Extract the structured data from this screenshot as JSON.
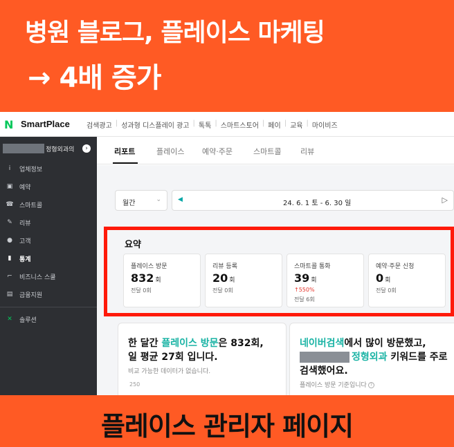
{
  "banner": {
    "headline": "병원 블로그, 플레이스 마케팅",
    "subline": "→ 4배 증가",
    "bottom": "플레이스 관리자 페이지"
  },
  "topbar": {
    "logo_mark": "N",
    "logo_text": "SmartPlace",
    "nav": [
      "검색광고",
      "성과형 디스플레이 광고",
      "톡톡",
      "스마트스토어",
      "페이",
      "교육",
      "마이비즈"
    ]
  },
  "sidebar": {
    "store_suffix": "정형외과의",
    "store_chevron": "›",
    "items": [
      {
        "label": "업체정보",
        "icon": "info-icon",
        "glyph": "i"
      },
      {
        "label": "예약",
        "icon": "calendar-icon",
        "glyph": "▣"
      },
      {
        "label": "스마트콜",
        "icon": "phone-icon",
        "glyph": "☎"
      },
      {
        "label": "리뷰",
        "icon": "pencil-icon",
        "glyph": "✎"
      },
      {
        "label": "고객",
        "icon": "users-icon",
        "glyph": "●"
      },
      {
        "label": "통계",
        "icon": "chart-icon",
        "glyph": "▮"
      },
      {
        "label": "비즈니스 스쿨",
        "icon": "school-icon",
        "glyph": "⌐"
      },
      {
        "label": "금융지원",
        "icon": "finance-icon",
        "glyph": "▤"
      },
      {
        "label": "솔루션",
        "icon": "solution-icon",
        "glyph": "✕"
      }
    ]
  },
  "tabs": [
    "리포트",
    "플레이스",
    "예약·주문",
    "스마트콜",
    "리뷰"
  ],
  "filters": {
    "period": "월간",
    "period_chevron": "⌄",
    "prev_glyph": "◀",
    "date_range": "24. 6. 1 토  -  6. 30 일",
    "next_glyph": "▷"
  },
  "summary": {
    "title": "요약",
    "cards": [
      {
        "label": "플레이스 방문",
        "value": "832",
        "unit": "회",
        "change": "",
        "prev": "전달 0회"
      },
      {
        "label": "리뷰 등록",
        "value": "20",
        "unit": "회",
        "change": "",
        "prev": "전달 0회"
      },
      {
        "label": "스마트콜 통화",
        "value": "39",
        "unit": "회",
        "change": "↑550%",
        "prev": "전달 6회"
      },
      {
        "label": "예약·주문 신청",
        "value": "0",
        "unit": "회",
        "change": "",
        "prev": "전달 0회"
      }
    ]
  },
  "panel_left": {
    "line1_a": "한 달간 ",
    "line1_hl": "플레이스 방문",
    "line1_b": "은 832회,",
    "line2": "일 평균 27회 입니다.",
    "note": "비교 가능한 데이터가 없습니다.",
    "tick": "250"
  },
  "panel_right": {
    "line1_hl": "네이버검색",
    "line1_b": "에서 많이 방문했고,",
    "line2_hl": "정형외과",
    "line2_b": " 키워드를 주로",
    "line3": "검색했어요.",
    "note": "플레이스 방문 기준입니다",
    "help": "?"
  },
  "colors": {
    "banner": "#ff5a24",
    "naver_green": "#03c75a",
    "highlight_box": "#ff1a0a",
    "teal_accent": "#19b3a4"
  }
}
